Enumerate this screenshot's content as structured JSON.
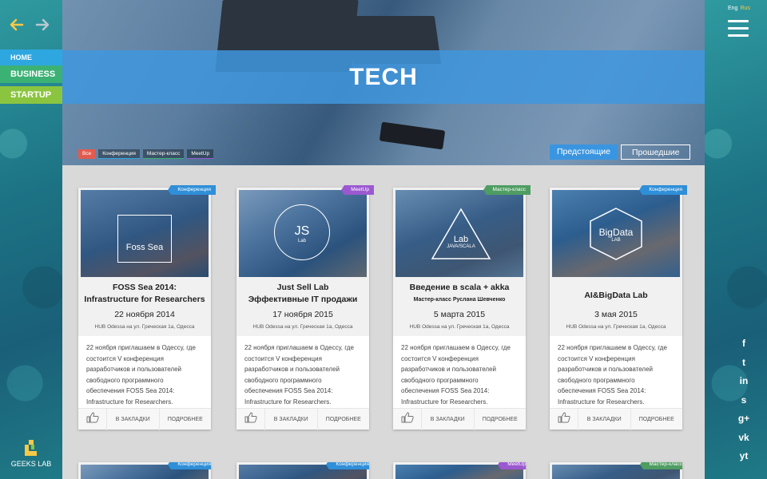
{
  "lang": {
    "eng": "Eng",
    "rus": "Rus"
  },
  "menu": {
    "home": "HOME",
    "business": "BUSINESS",
    "startup": "STARTUP"
  },
  "logo": {
    "text": "GEEKS LAB"
  },
  "hero": {
    "title": "TECH"
  },
  "filters": {
    "all": "Все",
    "conf": "Конференция",
    "mc": "Мастер-класс",
    "mu": "MeetUp"
  },
  "tabs": {
    "upcoming": "Предстоящие",
    "past": "Прошедшие"
  },
  "social": [
    "f",
    "t",
    "in",
    "s",
    "g+",
    "vk",
    "yt"
  ],
  "cards": [
    {
      "ribbon": "Конференция",
      "emblem": "Foss Sea",
      "title1": "FOSS Sea 2014:",
      "title2": "Infrastructure for Researchers",
      "date": "22 ноября 2014",
      "place": "HUB Odessa на  ул. Греческая 1а, Одесса",
      "desc": "22 ноября приглашаем в Одессу, где состоится V конференция разработчиков и пользователей свободного программного обеспечения FOSS Sea 2014: Infrastructure for Researchers.",
      "bookmark": "В ЗАКЛАДКИ",
      "more": "ПОДРОБНЕЕ"
    },
    {
      "ribbon": "MeetUp",
      "emblem": "JS",
      "emblem_sub": "Lab",
      "title1": "Just Sell Lab",
      "title2": "Эффективные IT продажи",
      "date": "17 ноября 2015",
      "place": "HUB Odessa на  ул. Греческая 1а, Одесса",
      "desc": "22 ноября приглашаем в Одессу, где состоится V конференция разработчиков и пользователей свободного программного обеспечения FOSS Sea 2014: Infrastructure for Researchers.",
      "bookmark": "В ЗАКЛАДКИ",
      "more": "ПОДРОБНЕЕ"
    },
    {
      "ribbon": "Мастер-класс",
      "emblem": "Lab",
      "emblem_sub": "JAVA/SCALA",
      "title1": "Введение в scala + akka",
      "subtitle": "Мастер-класс  Руслана Шевченко",
      "date": "5 марта 2015",
      "place": "HUB Odessa на  ул. Греческая 1а, Одесса",
      "desc": "22 ноября приглашаем в Одессу, где состоится V конференция разработчиков и пользователей свободного программного обеспечения FOSS Sea 2014: Infrastructure for Researchers.",
      "bookmark": "В ЗАКЛАДКИ",
      "more": "ПОДРОБНЕЕ"
    },
    {
      "ribbon": "Конференция",
      "emblem": "BigData",
      "emblem_sub": "LAB",
      "title1": "AI&BigData Lab",
      "date": "3 мая 2015",
      "place": "HUB Odessa на  ул. Греческая 1а, Одесса",
      "desc": "22 ноября приглашаем в Одессу, где состоится V конференция разработчиков и пользователей свободного программного обеспечения FOSS Sea 2014: Infrastructure for Researchers.",
      "bookmark": "В ЗАКЛАДКИ",
      "more": "ПОДРОБНЕЕ"
    }
  ],
  "row2_ribbons": [
    "Конференция",
    "Конференция",
    "MeetUp",
    "Мастер-класс"
  ]
}
